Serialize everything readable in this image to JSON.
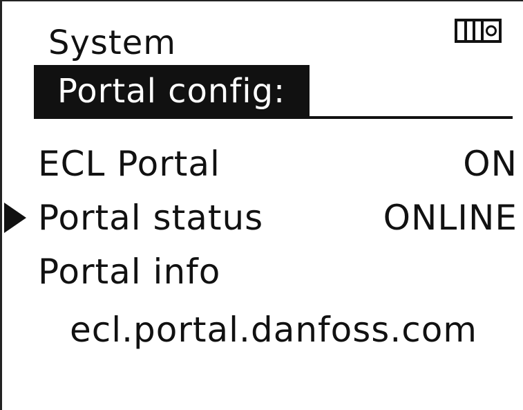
{
  "header": {
    "section_title": "System",
    "page_title": "Portal config:",
    "status_icon": "display-panel-icon"
  },
  "menu": {
    "items": [
      {
        "label": "ECL Portal",
        "value": "ON"
      },
      {
        "label": "Portal status",
        "value": "ONLINE"
      },
      {
        "label": "Portal info",
        "value": ""
      }
    ],
    "selected_index": 1,
    "info_url": "ecl.portal.danfoss.com"
  },
  "colors": {
    "foreground": "#111111",
    "background": "#ffffff",
    "inverse_text": "#ffffff"
  }
}
